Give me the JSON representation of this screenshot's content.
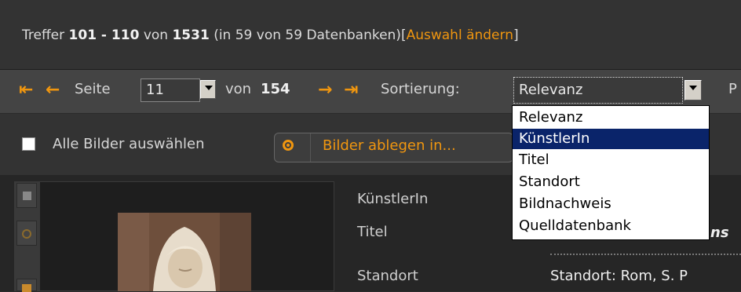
{
  "header": {
    "hits_prefix": "Treffer",
    "range": "101 - 110",
    "of_word": "von",
    "total": "1531",
    "db_info": "(in 59 von 59 Datenbanken)",
    "bracket_open": "[",
    "change_selection": "Auswahl ändern",
    "bracket_close": "]"
  },
  "pagination": {
    "page_label": "Seite",
    "current_page": "11",
    "of_label": "von",
    "total_pages": "154",
    "sort_label": "Sortierung:",
    "sort_selected": "Relevanz",
    "truncated_right": "P"
  },
  "sort_options": [
    "Relevanz",
    "KünstlerIn",
    "Titel",
    "Standort",
    "Bildnachweis",
    "Quelldatenbank"
  ],
  "sort_highlighted_index": 1,
  "selection": {
    "select_all_label": "Alle Bilder auswählen",
    "store_images_label": "Bilder ablegen in..."
  },
  "record": {
    "fields": [
      {
        "label": "KünstlerIn",
        "value": ""
      },
      {
        "label": "Titel",
        "value": "ns"
      },
      {
        "label": "Standort",
        "value": "Standort: Rom, S. P"
      }
    ]
  },
  "colors": {
    "accent": "#f0960f",
    "highlight": "#0a246a"
  },
  "icons": [
    "first-page-icon",
    "prev-page-icon",
    "next-page-icon",
    "last-page-icon",
    "dropdown-arrow-icon",
    "store-circle-icon",
    "select-square-icon",
    "grid-icon"
  ]
}
